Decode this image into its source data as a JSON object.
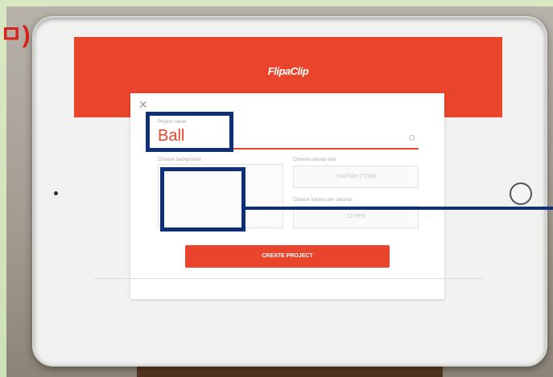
{
  "corner_fragment": "ㅁ)",
  "app": {
    "logo_text": "FlipaClip"
  },
  "dialog": {
    "close_icon": "close-icon",
    "project_name_label": "Project name",
    "project_name_value": "Ball",
    "choose_background_label": "Choose background",
    "choose_canvas_size_label": "Choose canvas size",
    "canvas_size_value": "YouTube (720p)",
    "choose_fps_label": "Choose frames per second",
    "fps_value": "12 FPS",
    "create_button_label": "CREATE PROJECT"
  },
  "colors": {
    "accent": "#e8452c",
    "annotation": "#0e2f7a",
    "corner_text": "#d9201c"
  }
}
